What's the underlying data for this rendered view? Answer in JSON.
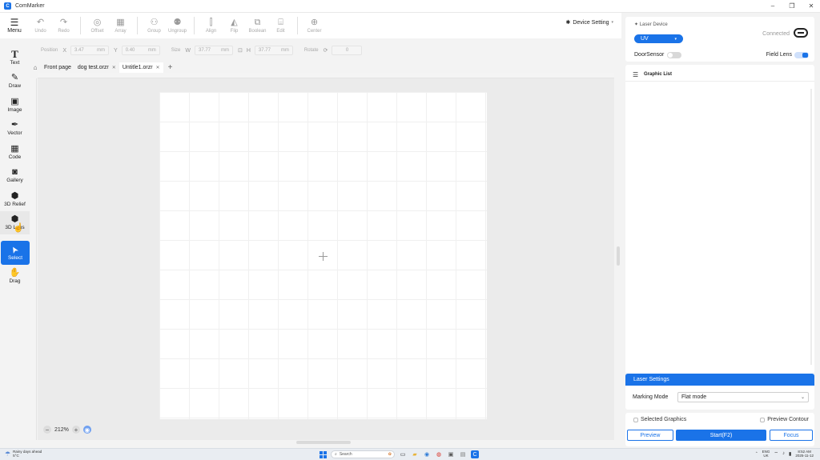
{
  "app": {
    "title": "ComMarker",
    "logo_glyph": "C",
    "accent_color": "#1a73e8"
  },
  "window_controls": {
    "minimize": "–",
    "restore": "❐",
    "close": "✕"
  },
  "toolbar": {
    "menu_label": "Menu",
    "undo": "Undo",
    "redo": "Redo",
    "offset": "Offset",
    "array": "Array",
    "group": "Group",
    "ungroup": "Ungroup",
    "align": "Align",
    "flip": "Flip",
    "boolean": "Boolean",
    "edit": "Edit",
    "center": "Center",
    "device_setting": "Device Setting"
  },
  "properties": {
    "position_label": "Position",
    "x_axis": "X",
    "x_value": "3.47",
    "y_axis": "Y",
    "y_value": "0.40",
    "size_label": "Size",
    "w_axis": "W",
    "w_value": "37.77",
    "h_axis": "H",
    "h_value": "37.77",
    "rotate_label": "Rotate",
    "rotate_value": "0",
    "unit": "mm"
  },
  "tools": [
    {
      "label": "Text",
      "icon": "T"
    },
    {
      "label": "Draw",
      "icon": "✎"
    },
    {
      "label": "Image",
      "icon": "▣"
    },
    {
      "label": "Vector",
      "icon": "✒"
    },
    {
      "label": "Code",
      "icon": "▦"
    },
    {
      "label": "Gallery",
      "icon": "◙"
    },
    {
      "label": "3D Relief",
      "icon": "⬢"
    },
    {
      "label": "3D Lens",
      "icon": "⬢"
    },
    {
      "label": "Select",
      "icon": "➤"
    },
    {
      "label": "Drag",
      "icon": "✋"
    }
  ],
  "doc_tabs": {
    "home": "Front page",
    "tabs": [
      {
        "label": "dog test.orzr"
      },
      {
        "label": "Untitle1.orzr"
      }
    ],
    "close_glyph": "✕",
    "add_glyph": "+"
  },
  "canvas": {
    "zoom": "212%",
    "zoom_out": "−",
    "zoom_in": "+"
  },
  "device_panel": {
    "laser_device_label": "Laser Device",
    "device_value": "UV",
    "connection_status": "Connected",
    "door_sensor_label": "DoorSensor",
    "door_sensor_on": false,
    "field_lens_label": "Field Lens",
    "field_lens_on": true
  },
  "graphic_list": {
    "title": "Graphic List",
    "items": []
  },
  "laser_settings": {
    "title": "Laser Settings",
    "marking_mode_label": "Marking Mode",
    "marking_mode_value": "Flat mode"
  },
  "bottom_actions": {
    "selected_graphics": "Selected Graphics",
    "preview_contour": "Preview Contour",
    "preview": "Preview",
    "start": "Start(F2)",
    "focus": "Focus"
  },
  "taskbar": {
    "weather_line1": "Rainy days ahead",
    "weather_line2": "5°C",
    "search": "Search",
    "lang_line1": "ENG",
    "lang_line2": "UK",
    "time": "8:52 AM",
    "date": "2025-11-12"
  }
}
